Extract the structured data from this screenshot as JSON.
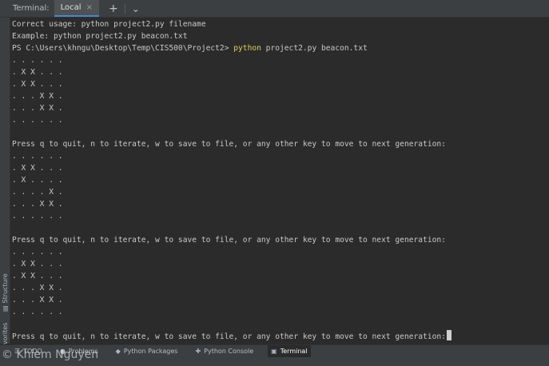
{
  "tabbar": {
    "tool_title": "Terminal:",
    "tab_label": "Local",
    "close_glyph": "×",
    "add_glyph": "+",
    "menu_glyph": "⌄"
  },
  "sidebar": {
    "structure_label": "Structure",
    "favorites_label": "Favorites"
  },
  "terminal": {
    "lines": [
      {
        "text": "Correct usage: python project2.py filename"
      },
      {
        "text": "Example: python project2.py beacon.txt"
      },
      {
        "prompt": "PS C:\\Users\\khngu\\Desktop\\Temp\\CIS500\\Project2> ",
        "cmd": "python",
        "args": " project2.py beacon.txt"
      },
      {
        "text": ". . . . . ."
      },
      {
        "text": ". X X . . ."
      },
      {
        "text": ". X X . . ."
      },
      {
        "text": ". . . X X ."
      },
      {
        "text": ". . . X X ."
      },
      {
        "text": ". . . . . ."
      },
      {
        "text": ""
      },
      {
        "text": "Press q to quit, n to iterate, w to save to file, or any other key to move to next generation:"
      },
      {
        "text": ". . . . . ."
      },
      {
        "text": ". X X . . ."
      },
      {
        "text": ". X . . . ."
      },
      {
        "text": ". . . . X ."
      },
      {
        "text": ". . . X X ."
      },
      {
        "text": ". . . . . ."
      },
      {
        "text": ""
      },
      {
        "text": "Press q to quit, n to iterate, w to save to file, or any other key to move to next generation:"
      },
      {
        "text": ". . . . . ."
      },
      {
        "text": ". X X . . ."
      },
      {
        "text": ". X X . . ."
      },
      {
        "text": ". . . X X ."
      },
      {
        "text": ". . . X X ."
      },
      {
        "text": ". . . . . ."
      },
      {
        "text": ""
      },
      {
        "text": "Press q to quit, n to iterate, w to save to file, or any other key to move to next generation:",
        "cursor": true
      }
    ]
  },
  "bottombar": {
    "items": [
      {
        "label": "TODO",
        "icon": "list-icon"
      },
      {
        "label": "Problems",
        "icon": "problems-icon"
      },
      {
        "label": "Python Packages",
        "icon": "packages-icon"
      },
      {
        "label": "Python Console",
        "icon": "console-icon"
      },
      {
        "label": "Terminal",
        "icon": "terminal-icon",
        "active": true
      }
    ]
  },
  "watermark": {
    "text": "© Khiem Nguyen"
  },
  "colors": {
    "background": "#2b2b2b",
    "panel": "#3c3f41",
    "text": "#c8c8c8",
    "command_highlight": "#e0cc5a",
    "tab_accent": "#4a88c7"
  }
}
